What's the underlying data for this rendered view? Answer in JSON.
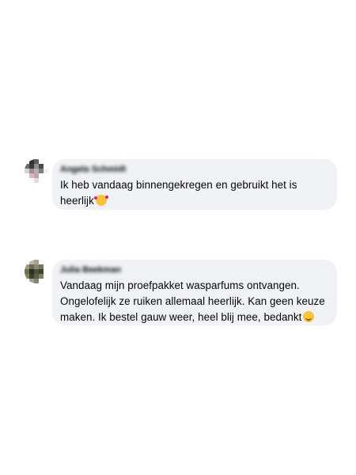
{
  "comments": [
    {
      "author": "Angela Schmidt",
      "avatar_colors": [
        "#ffffff",
        "#2f3033",
        "#5b5e63",
        "#ffffff",
        "#ffffff",
        "#6a6c70",
        "#3a3b3e",
        "#8e8f93",
        "#4a4b4f",
        "#ffffff",
        "#d7d4d6",
        "#9c8e92",
        "#b7aeb2",
        "#7b7d80",
        "#eeeeef",
        "#ffffff",
        "#d9b7c1",
        "#c9a1ae",
        "#ffffff",
        "#ffffff",
        "#ffffff",
        "#ffffff",
        "#e7d8dd",
        "#ffffff",
        "#ffffff"
      ],
      "text": "Ik heb vandaag binnengekregen en gebruikt het is heerlijk",
      "emoji": "smiling-face-with-hearts-icon"
    },
    {
      "author": "Julia Beekman",
      "avatar_colors": [
        "#ffffff",
        "#bdb7a7",
        "#a9a18f",
        "#ffffff",
        "#ffffff",
        "#9c9a84",
        "#6b6b55",
        "#8d8a74",
        "#77745f",
        "#ffffff",
        "#6c714d",
        "#2b2f22",
        "#4d5238",
        "#40432e",
        "#ffffff",
        "#7b8660",
        "#39402d",
        "#5a6045",
        "#7d8062",
        "#ffffff",
        "#ffffff",
        "#a1a48b",
        "#7f8470",
        "#ffffff",
        "#ffffff"
      ],
      "text": "Vandaag mijn proefpakket wasparfums ontvangen. Ongelofelijk ze ruiken allemaal heerlijk. Kan geen keuze maken. Ik bestel gauw weer, heel blij mee, bedankt",
      "emoji": "smiling-face-icon"
    }
  ]
}
